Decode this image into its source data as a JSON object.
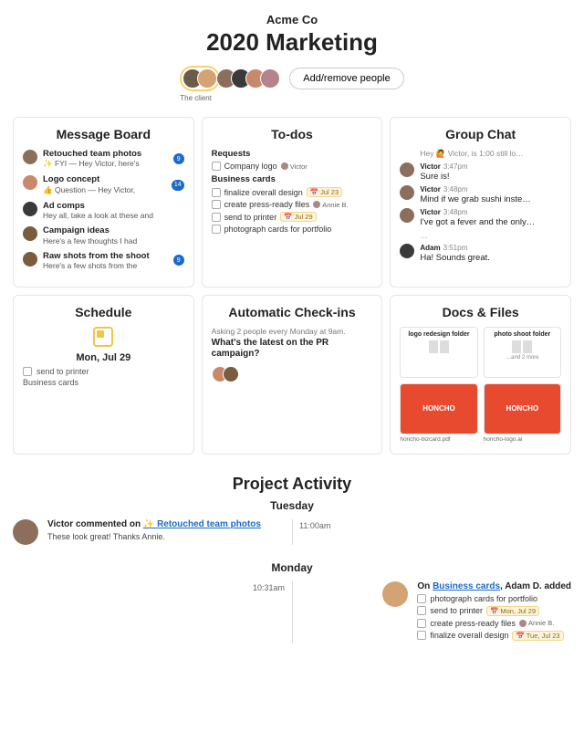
{
  "header": {
    "org": "Acme Co",
    "project": "2020 Marketing",
    "client_label": "The client",
    "add_people_label": "Add/remove people"
  },
  "cards": {
    "message_board": {
      "title": "Message Board",
      "items": [
        {
          "title": "Retouched team photos",
          "sub": "✨ FYI — Hey Victor, here's",
          "badge": "9"
        },
        {
          "title": "Logo concept",
          "sub": "👍 Question — Hey Victor,",
          "badge": "14"
        },
        {
          "title": "Ad comps",
          "sub": "Hey all, take a look at these and",
          "badge": ""
        },
        {
          "title": "Campaign ideas",
          "sub": "Here's a few thoughts I had",
          "badge": ""
        },
        {
          "title": "Raw shots from the shoot",
          "sub": "Here's a few shots from the",
          "badge": "9"
        }
      ]
    },
    "todos": {
      "title": "To-dos",
      "lists": [
        {
          "name": "Requests",
          "items": [
            {
              "text": "Company logo",
              "assignee": "Victor"
            }
          ]
        },
        {
          "name": "Business cards",
          "items": [
            {
              "text": "finalize overall design",
              "due": "Jul 23"
            },
            {
              "text": "create press-ready files",
              "assignee": "Annie B."
            },
            {
              "text": "send to printer",
              "due": "Jul 29"
            },
            {
              "text": "photograph cards for portfolio"
            }
          ]
        }
      ]
    },
    "group_chat": {
      "title": "Group Chat",
      "overflow": "Hey 🙋 Victor, is 1:00 still lo…",
      "messages": [
        {
          "name": "Victor",
          "time": "3:47pm",
          "text": "Sure is!"
        },
        {
          "name": "Victor",
          "time": "3:48pm",
          "text": "Mind if we grab sushi inste…"
        },
        {
          "name": "Victor",
          "time": "3:48pm",
          "text": "I've got a fever and the only…"
        },
        {
          "name": "",
          "time": "",
          "text": "…"
        },
        {
          "name": "Adam",
          "time": "3:51pm",
          "text": "Ha! Sounds great."
        }
      ]
    },
    "schedule": {
      "title": "Schedule",
      "date": "Mon, Jul 29",
      "items": [
        {
          "text": "send to printer",
          "check": true
        },
        {
          "text": "Business cards",
          "check": false
        }
      ]
    },
    "checkins": {
      "title": "Automatic Check-ins",
      "sub": "Asking 2 people every Monday at 9am.",
      "question": "What's the latest on the PR campaign?"
    },
    "docs": {
      "title": "Docs & Files",
      "items": [
        {
          "label": "logo redesign folder"
        },
        {
          "label": "photo shoot folder",
          "extra": "…and 2 more"
        },
        {
          "label": "honcho-bizcard.pdf",
          "red": true
        },
        {
          "label": "honcho-logo.ai",
          "red": true
        }
      ]
    }
  },
  "activity": {
    "title": "Project Activity",
    "days": [
      {
        "label": "Tuesday",
        "events": [
          {
            "side": "left",
            "time": "11:00am",
            "prefix": "Victor commented on ",
            "link": "✨ Retouched team photos",
            "sub": "These look great! Thanks Annie."
          }
        ]
      },
      {
        "label": "Monday",
        "events": [
          {
            "side": "right",
            "time": "10:31am",
            "prefix": "On ",
            "link": "Business cards",
            "suffix": ", Adam D. added",
            "todos": [
              {
                "text": "photograph cards for portfolio"
              },
              {
                "text": "send to printer",
                "due": "Mon, Jul 29"
              },
              {
                "text": "create press-ready files",
                "assignee": "Annie B."
              },
              {
                "text": "finalize overall design",
                "due": "Tue, Jul 23"
              }
            ]
          }
        ]
      }
    ]
  }
}
